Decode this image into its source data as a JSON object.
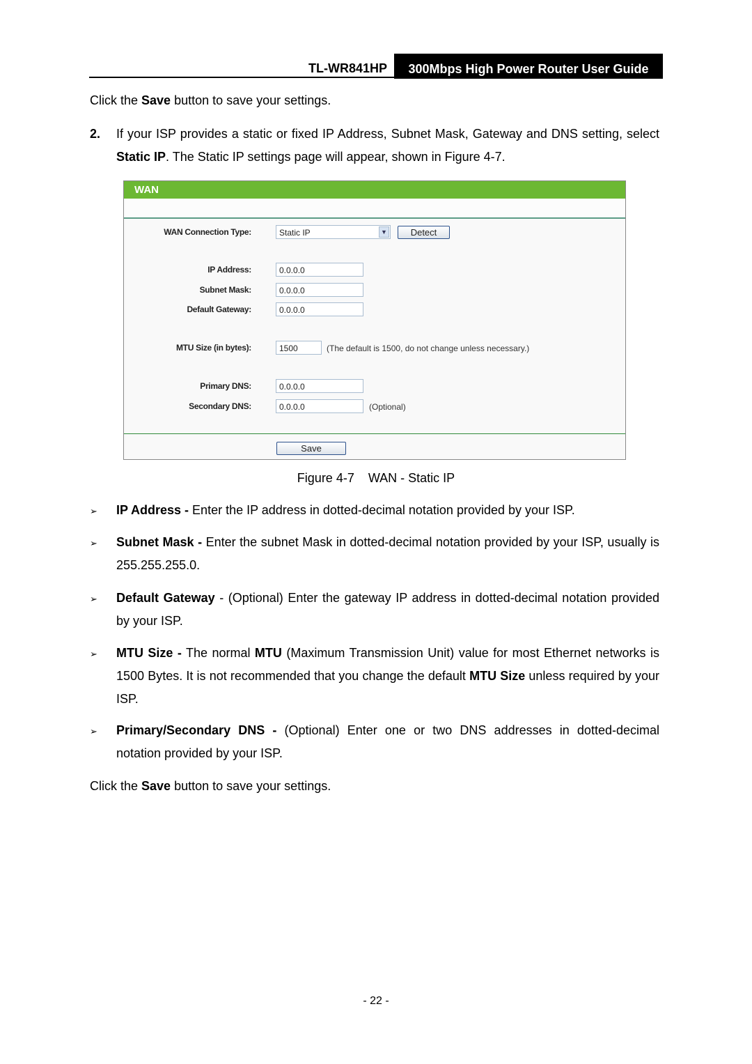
{
  "header": {
    "model": "TL-WR841HP",
    "title": "300Mbps High Power Router User Guide"
  },
  "intro": [
    {
      "t": "Click the "
    },
    {
      "t": "Save",
      "b": true
    },
    {
      "t": " button to save your settings."
    }
  ],
  "step2": {
    "number": "2.",
    "text": [
      {
        "t": "If your ISP provides a static or fixed IP Address, Subnet Mask, Gateway and DNS setting, select "
      },
      {
        "t": "Static IP",
        "b": true
      },
      {
        "t": ". The Static IP settings page will appear, shown in Figure 4-7."
      }
    ]
  },
  "figure": {
    "header": "WAN",
    "accent_color": "#6cb833",
    "connection_type_label": "WAN Connection Type:",
    "connection_type_value": "Static IP",
    "detect_label": "Detect",
    "ip_label": "IP Address:",
    "ip_value": "0.0.0.0",
    "mask_label": "Subnet Mask:",
    "mask_value": "0.0.0.0",
    "gateway_label": "Default Gateway:",
    "gateway_value": "0.0.0.0",
    "mtu_label": "MTU Size (in bytes):",
    "mtu_value": "1500",
    "mtu_note": "(The default is 1500, do not change unless necessary.)",
    "dns1_label": "Primary DNS:",
    "dns1_value": "0.0.0.0",
    "dns2_label": "Secondary DNS:",
    "dns2_value": "0.0.0.0",
    "dns2_note": "(Optional)",
    "save_label": "Save",
    "caption": "Figure 4-7    WAN - Static IP"
  },
  "bullets": [
    [
      {
        "t": "IP Address -",
        "b": true
      },
      {
        "t": " Enter the IP address in dotted-decimal notation provided by your ISP."
      }
    ],
    [
      {
        "t": "Subnet Mask -",
        "b": true
      },
      {
        "t": " Enter the subnet Mask in dotted-decimal notation provided by your ISP, usually is 255.255.255.0."
      }
    ],
    [
      {
        "t": "Default Gateway",
        "b": true
      },
      {
        "t": " - (Optional) Enter the gateway IP address in dotted-decimal notation provided by your ISP."
      }
    ],
    [
      {
        "t": "MTU Size -",
        "b": true
      },
      {
        "t": " The normal "
      },
      {
        "t": "MTU",
        "b": true
      },
      {
        "t": " (Maximum Transmission Unit) value for most Ethernet networks is 1500 Bytes. It is not recommended that you change the default "
      },
      {
        "t": "MTU Size",
        "b": true
      },
      {
        "t": " unless required by your ISP."
      }
    ],
    [
      {
        "t": "Primary/Secondary DNS -",
        "b": true
      },
      {
        "t": " (Optional) Enter one or two DNS addresses in dotted-decimal notation provided by your ISP."
      }
    ]
  ],
  "outro": [
    {
      "t": "Click the "
    },
    {
      "t": "Save",
      "b": true
    },
    {
      "t": " button to save your settings."
    }
  ],
  "page_number": "- 22 -"
}
